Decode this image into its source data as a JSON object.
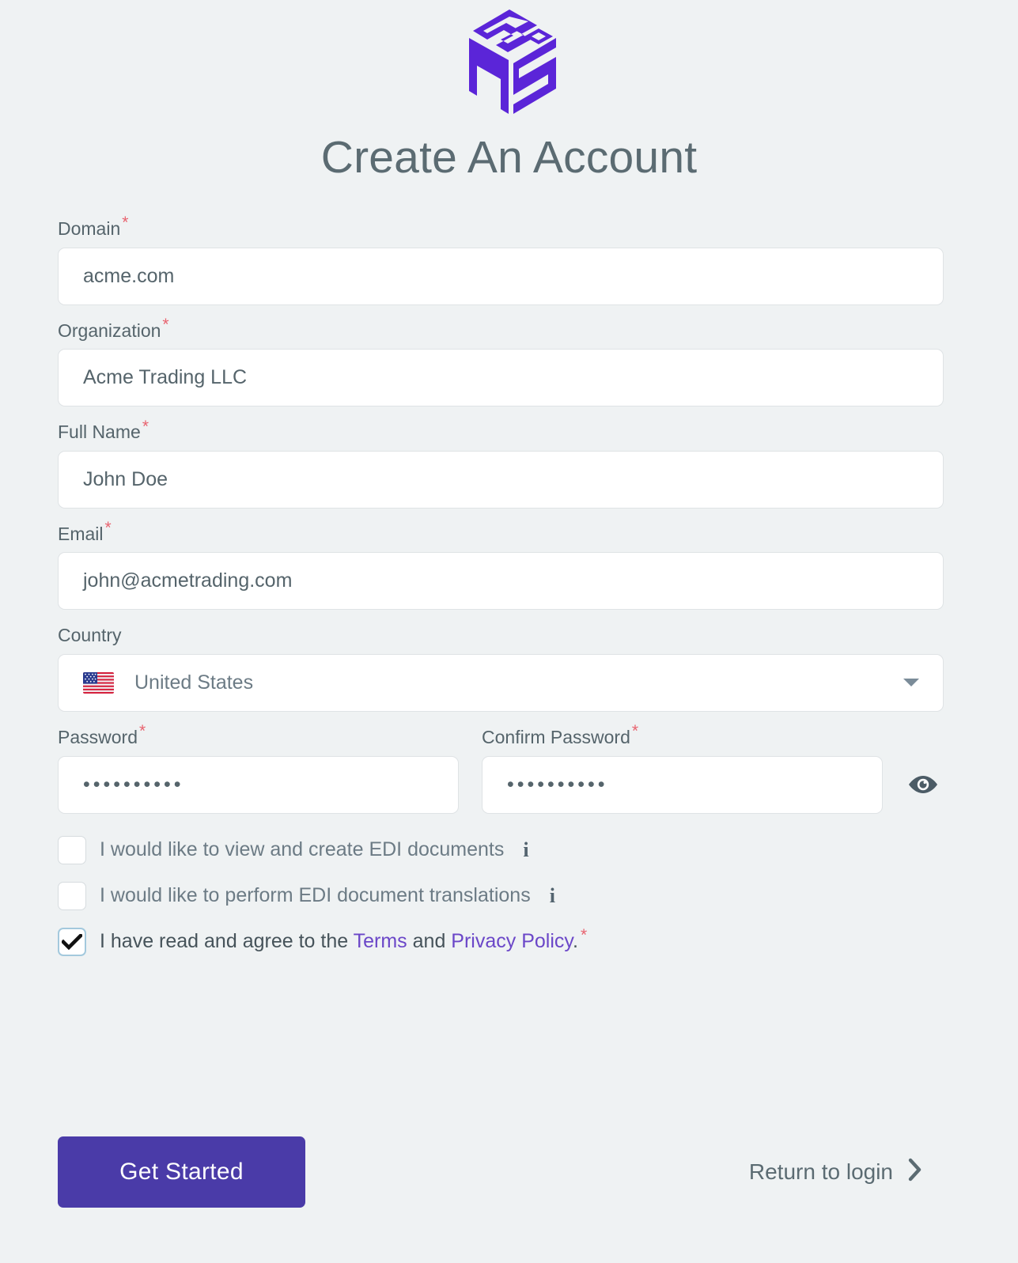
{
  "brand": {
    "logo_icon": "cube-logo-icon",
    "logo_color": "#5b25d8"
  },
  "header": {
    "title": "Create An Account"
  },
  "form": {
    "required_marker": "*",
    "fields": [
      {
        "label": "Domain",
        "required": true,
        "value": "acme.com",
        "placeholder": "Domain",
        "name": "domain"
      },
      {
        "label": "Organization",
        "required": true,
        "value": "Acme Trading LLC",
        "placeholder": "Organization",
        "name": "organization"
      },
      {
        "label": "Full Name",
        "required": true,
        "value": "John Doe",
        "placeholder": "Full Name",
        "name": "full-name"
      },
      {
        "label": "Email",
        "required": true,
        "value": "john@acmetrading.com",
        "placeholder": "Email",
        "name": "email"
      }
    ],
    "country": {
      "label": "Country",
      "required": false,
      "selected": "United States",
      "flag_icon": "flag-united-states-icon",
      "caret_icon": "chevron-down-icon",
      "options": [
        "United States"
      ]
    },
    "password": {
      "label": "Password",
      "required": true,
      "masked_value": "••••••••••",
      "char_count": 10,
      "placeholder": "Password"
    },
    "confirm_password": {
      "label": "Confirm Password",
      "required": true,
      "masked_value": "••••••••••",
      "char_count": 10,
      "placeholder": "Confirm Password"
    },
    "toggle_visibility": {
      "icon": "eye-icon",
      "state": "hidden"
    },
    "checkboxes": [
      {
        "label": "I would like to view and create EDI documents",
        "checked": false,
        "info_icon": "info-icon",
        "info_glyph": "i",
        "name": "view-create-edi"
      },
      {
        "label": "I would like to perform EDI document translations",
        "checked": false,
        "info_icon": "info-icon",
        "info_glyph": "i",
        "name": "perform-edi-translations"
      }
    ],
    "terms": {
      "checked": true,
      "check_glyph": "✔",
      "text_before": "I have read and agree to the ",
      "terms_link": "Terms",
      "text_middle": " and ",
      "privacy_link": "Privacy Policy",
      "text_after": ".",
      "required": true,
      "link_color": "#6b47c8"
    }
  },
  "footer": {
    "submit_label": "Get Started",
    "submit_color": "#4a3ba8",
    "return_label": "Return to login",
    "return_icon": "chevron-right-icon"
  }
}
